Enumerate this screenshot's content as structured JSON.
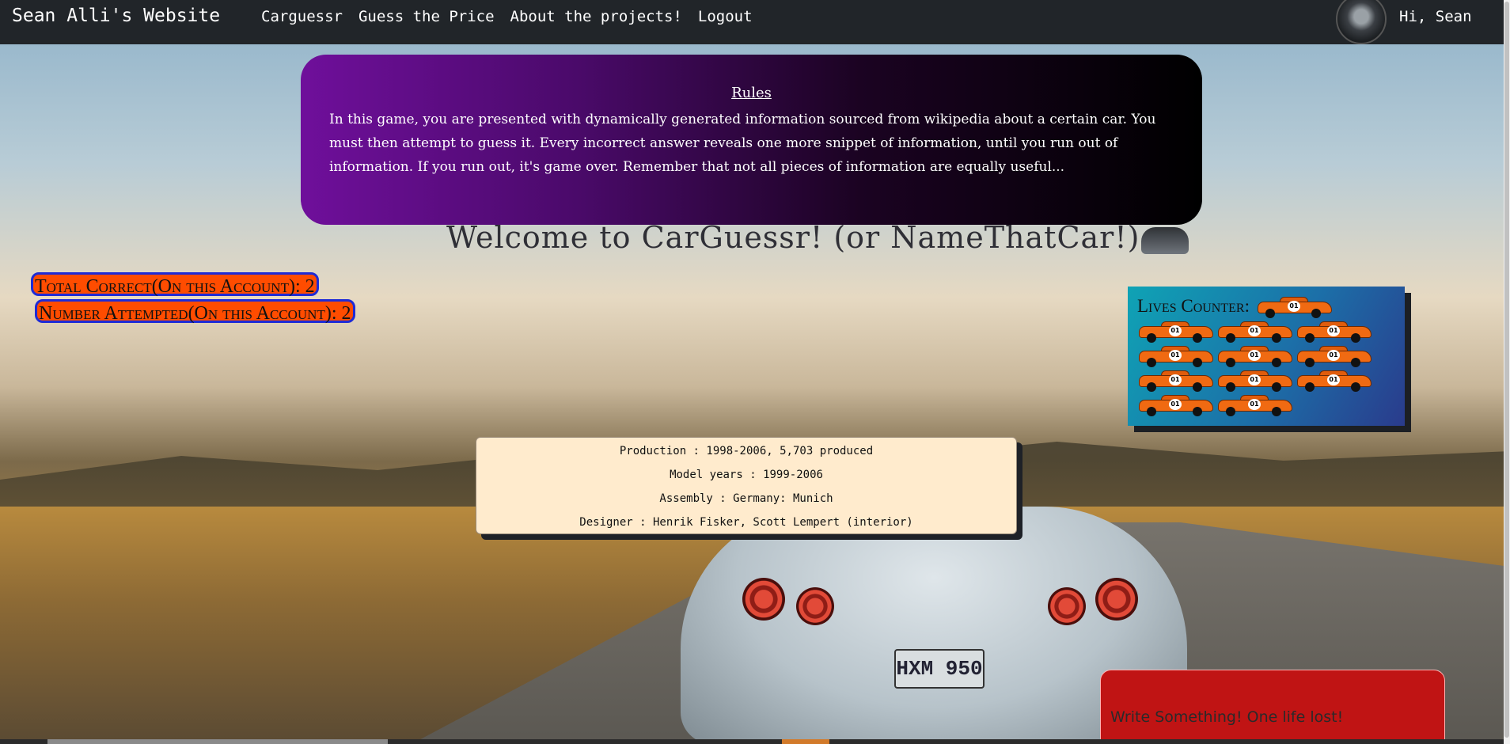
{
  "navbar": {
    "brand": "Sean Alli's Website",
    "links": [
      "Carguessr",
      "Guess the Price",
      "About the projects!",
      "Logout"
    ],
    "greeting": "Hi, Sean"
  },
  "rules": {
    "title": "Rules",
    "text": "In this game, you are presented with dynamically generated information sourced from wikipedia about a certain car. You must then attempt to guess it. Every incorrect answer reveals one more snippet of information, until you run out of information. If you run out, it's game over. Remember that not all pieces of information are equally useful..."
  },
  "welcome": "Welcome to CarGuessr! (or NameThatCar!)",
  "stats": {
    "total_correct": "Total Correct(On this Account): 2",
    "number_attempted": "Number Attempted(On this Account): 2"
  },
  "lives": {
    "label": "Lives Counter:",
    "count": 12,
    "icon": "general-lee-car-icon",
    "car_number": "01"
  },
  "car_info": [
    "Production : 1998-2006, 5,703 produced",
    "Model years : 1999-2006",
    "Assembly : Germany: Munich",
    "Designer : Henrik Fisker, Scott Lempert (interior)"
  ],
  "guess": {
    "placeholder": "Write Something! One life lost!"
  },
  "background": {
    "plate_text": "HXM 950"
  },
  "colors": {
    "navbar": "#212529",
    "rules_gradient_start": "#6f0f9b",
    "stat_badge": "#ff4c00",
    "stat_border": "#1e2bd6",
    "info_panel": "#ffebcd",
    "guess_box": "#c01414"
  }
}
